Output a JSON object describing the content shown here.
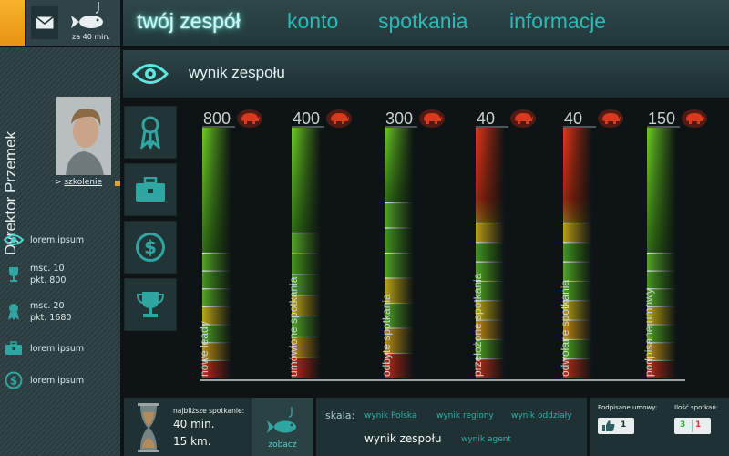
{
  "header": {
    "fish_label": "za 40 min.",
    "tabs": [
      {
        "label": "twój zespół",
        "active": true
      },
      {
        "label": "konto",
        "active": false
      },
      {
        "label": "spotkania",
        "active": false
      },
      {
        "label": "informacje",
        "active": false
      }
    ]
  },
  "sidebar": {
    "title": "Dyrektor Przemek",
    "szkolenie_prefix": ">",
    "szkolenie": "szkolenie",
    "items": [
      {
        "icon": "eye-icon",
        "line1": "lorem ipsum",
        "line2": ""
      },
      {
        "icon": "trophy-icon",
        "line1": "msc. 10",
        "line2": "pkt. 800"
      },
      {
        "icon": "ribbon-icon",
        "line1": "msc. 20",
        "line2": "pkt. 1680"
      },
      {
        "icon": "briefcase-icon",
        "line1": "lorem ipsum",
        "line2": ""
      },
      {
        "icon": "dollar-icon",
        "line1": "lorem ipsum",
        "line2": ""
      }
    ]
  },
  "section": {
    "title": "wynik zespołu",
    "categories": [
      "ribbon-icon",
      "briefcase-icon",
      "dollar-icon",
      "trophy-icon"
    ]
  },
  "chart_data": {
    "type": "bar",
    "series": [
      {
        "name": "nowe leady",
        "value": 800,
        "level": 1.0,
        "marks": 6,
        "tone": "green"
      },
      {
        "name": "umówione spotkania",
        "value": 400,
        "level": 1.0,
        "marks": 6,
        "tone": "green"
      },
      {
        "name": "odbyte spotkania",
        "value": 300,
        "level": 1.0,
        "marks": 7,
        "tone": "green"
      },
      {
        "name": "przełożone spotkania",
        "value": 40,
        "level": 1.0,
        "marks": 7,
        "tone": "red"
      },
      {
        "name": "odwołane spotkania",
        "value": 40,
        "level": 1.0,
        "marks": 7,
        "tone": "red"
      },
      {
        "name": "podpisane umowy",
        "value": 150,
        "level": 1.0,
        "marks": 7,
        "tone": "green"
      }
    ]
  },
  "bottom": {
    "meeting_caption": "najbliższe spotkanie:",
    "meeting_time": "40 min.",
    "meeting_distance": "15 km.",
    "see_label": "zobacz",
    "scale_label": "skala:",
    "scale_options": [
      "wynik Polska",
      "wynik regiony",
      "wynik oddziały",
      "wynik zespołu",
      "wynik agent"
    ],
    "scale_active": "wynik zespołu",
    "contracts_label": "Podpisane umowy:",
    "contracts_count": "1",
    "meetings_label": "Ilość spotkań:",
    "meetings_done": "3",
    "meetings_missed": "1"
  },
  "colors": {
    "accent": "#2fb8b6",
    "orange": "#f0a020",
    "green": "#5fbf2a",
    "red": "#d9361e",
    "yellow": "#e1c21a"
  }
}
